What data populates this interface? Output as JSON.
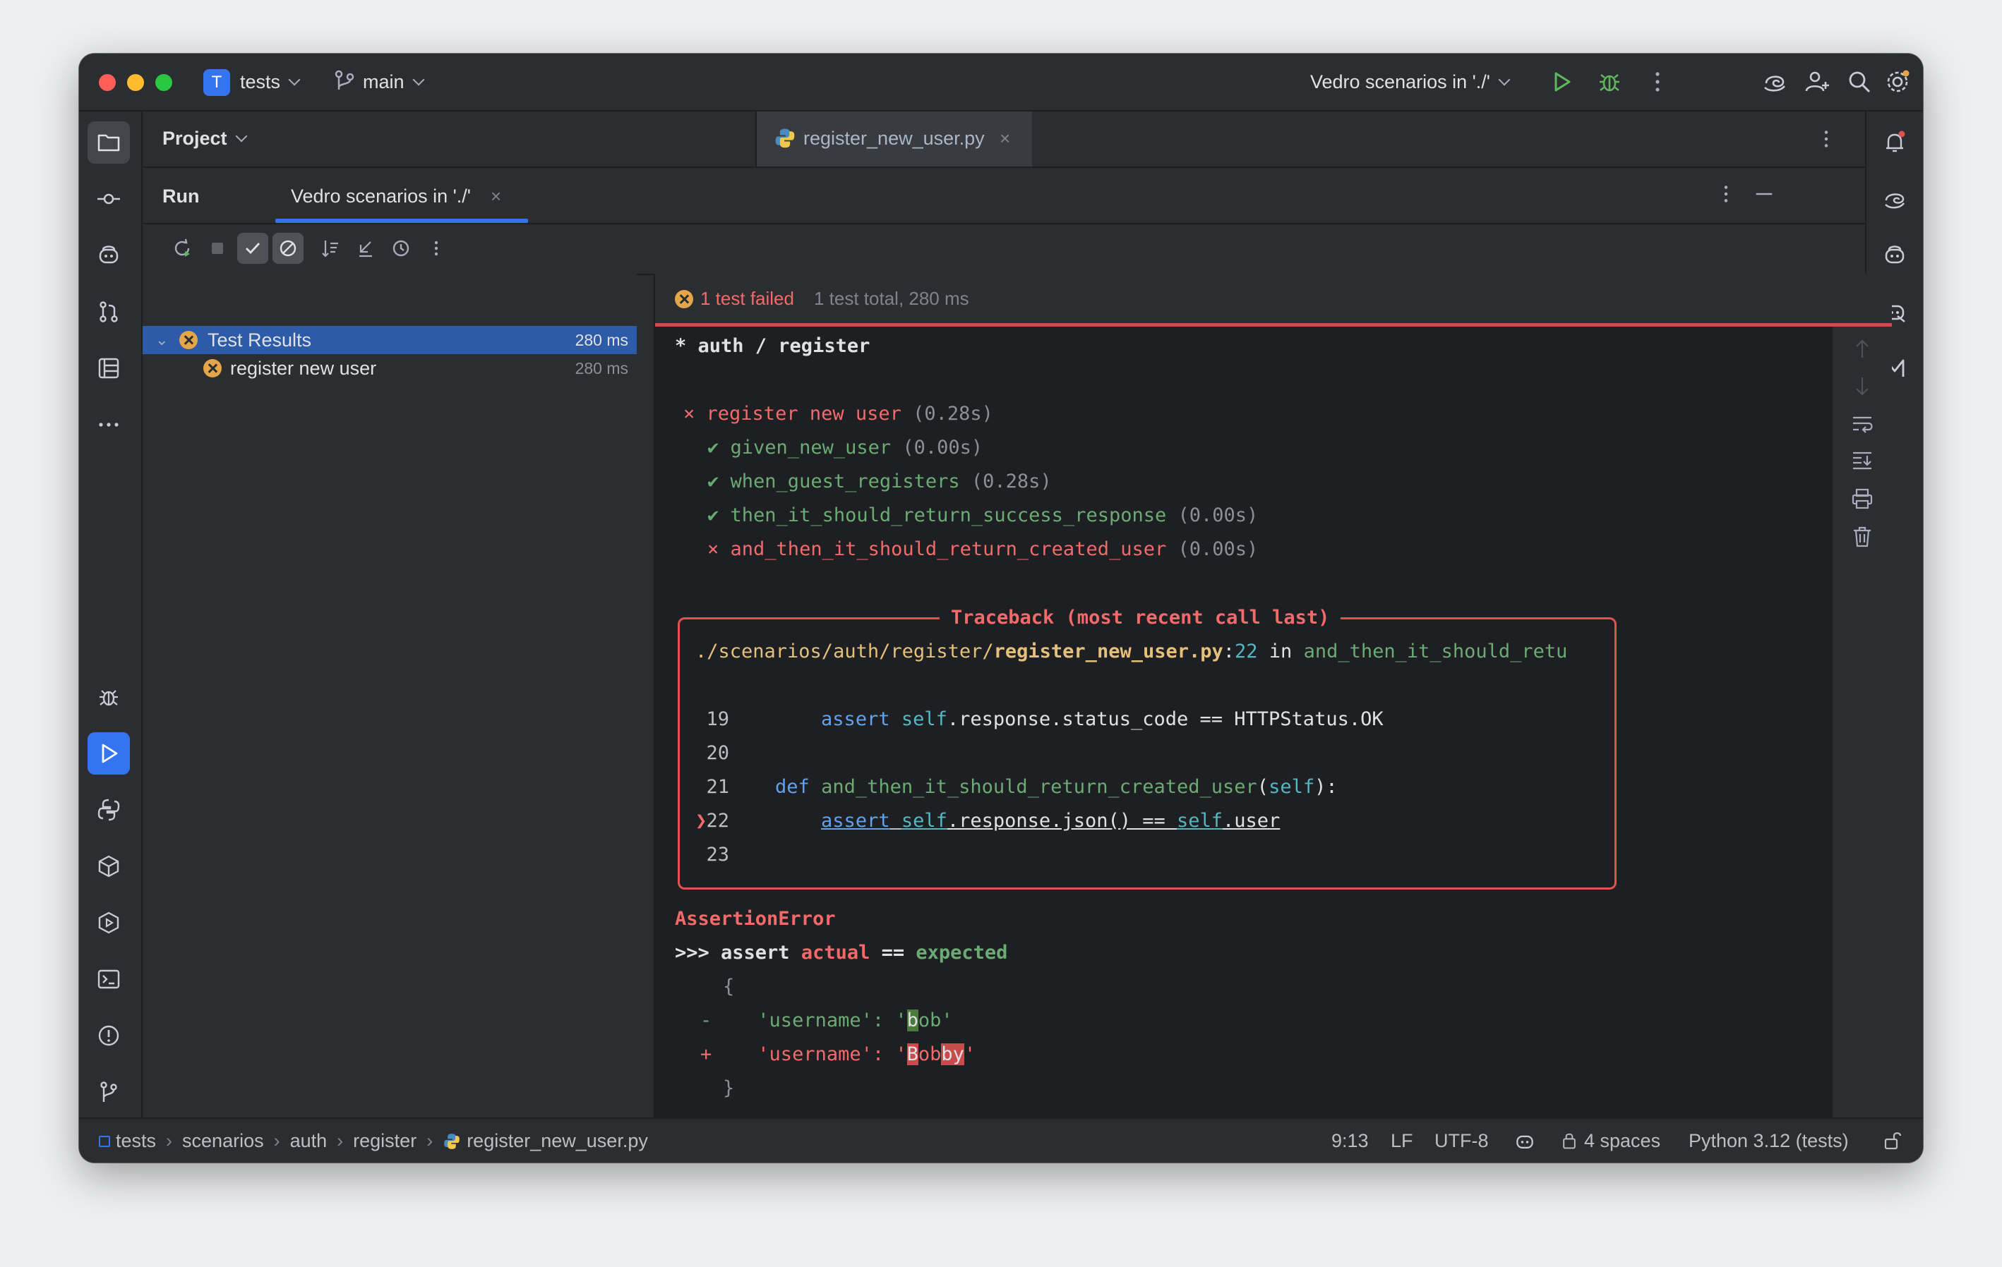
{
  "titlebar": {
    "project_badge": "T",
    "project_name": "tests",
    "branch": "main",
    "run_config": "Vedro scenarios in './'"
  },
  "project_panel": {
    "title": "Project"
  },
  "editor": {
    "tab_label": "register_new_user.py"
  },
  "run": {
    "title": "Run",
    "tab_label": "Vedro scenarios in './'",
    "close_glyph": "×"
  },
  "tree": {
    "root": {
      "label": "Test Results",
      "duration": "280 ms"
    },
    "items": [
      {
        "label": "register new user",
        "duration": "280 ms"
      }
    ]
  },
  "console": {
    "status": {
      "failed": "1 test failed",
      "summary": "1 test total, 280 ms"
    },
    "scenario_header": "* auth / register",
    "scenario": {
      "mark": "×",
      "name": "register new user",
      "time": "(0.28s)"
    },
    "steps": [
      {
        "mark": "✔",
        "name": "given_new_user",
        "time": "(0.00s)",
        "status": "pass"
      },
      {
        "mark": "✔",
        "name": "when_guest_registers",
        "time": "(0.28s)",
        "status": "pass"
      },
      {
        "mark": "✔",
        "name": "then_it_should_return_success_response",
        "time": "(0.00s)",
        "status": "pass"
      },
      {
        "mark": "×",
        "name": "and_then_it_should_return_created_user",
        "time": "(0.00s)",
        "status": "fail"
      }
    ],
    "traceback": {
      "title": "Traceback (most recent call last)",
      "path_prefix": "./scenarios/auth/register/",
      "path_file": "register_new_user.py",
      "path_colon": ":",
      "path_line": "22",
      "path_in": " in ",
      "path_func": "and_then_it_should_retu",
      "lines": [
        {
          "num": "19",
          "kw": "assert",
          "rest_self": "self",
          "rest": ".response.status_code == HTTPStatus.OK"
        },
        {
          "num": "20"
        },
        {
          "num": "21",
          "kw": "def",
          "fn": "and_then_it_should_return_created_user",
          "open": "(",
          "param": "self",
          "close": "):"
        },
        {
          "num": "22",
          "marker": "❯",
          "kw": "assert",
          "self1": "self",
          "mid": ".response.json() == ",
          "self2": "self",
          "tail": ".user"
        },
        {
          "num": "23"
        }
      ]
    },
    "error": {
      "name": "AssertionError",
      "prompt": ">>> assert ",
      "actual": "actual",
      "eq": " == ",
      "expected": "expected",
      "open_brace": "{",
      "minus_sign": "-",
      "minus_key": "'username': '",
      "minus_hl": "b",
      "minus_val": "ob",
      "minus_end": "'",
      "plus_sign": "+",
      "plus_key": "'username': '",
      "plus_hl1": "B",
      "plus_val": "ob",
      "plus_hl2": "by",
      "plus_end": "'",
      "close_brace": "}"
    }
  },
  "statusbar": {
    "breadcrumbs": [
      "tests",
      "scenarios",
      "auth",
      "register",
      "register_new_user.py"
    ],
    "crumb_sep": "›",
    "position": "9:13",
    "line_ending": "LF",
    "encoding": "UTF-8",
    "indent": "4 spaces",
    "interpreter": "Python 3.12 (tests)"
  },
  "colors": {
    "accent": "#3574f0",
    "error": "#f26a6a",
    "success": "#6aab73",
    "background": "#2b2d30",
    "console_bg": "#1e1f22"
  }
}
